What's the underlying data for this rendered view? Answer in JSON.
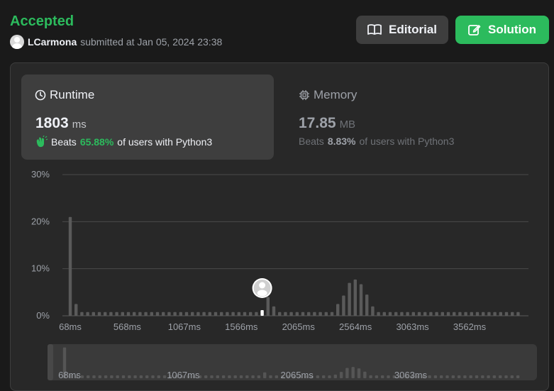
{
  "header": {
    "status": "Accepted",
    "username": "LCarmona",
    "submitted_text": "submitted at Jan 05, 2024 23:38",
    "editorial_label": "Editorial",
    "solution_label": "Solution"
  },
  "runtime": {
    "label": "Runtime",
    "value": "1803",
    "unit": "ms",
    "beats_label": "Beats",
    "beats_pct": "65.88%",
    "beats_suffix": "of users with Python3"
  },
  "memory": {
    "label": "Memory",
    "value": "17.85",
    "unit": "MB",
    "beats_label": "Beats",
    "beats_pct": "8.83%",
    "beats_suffix": "of users with Python3"
  },
  "colors": {
    "accent_green": "#2cbb5d",
    "bar": "#5a5a5a",
    "highlight_bar": "#ffffff"
  },
  "chart_data": {
    "type": "bar",
    "ylim": [
      0,
      30
    ],
    "y_ticks": [
      "30%",
      "20%",
      "10%",
      "0%"
    ],
    "x_tick_labels": [
      "68ms",
      "568ms",
      "1067ms",
      "1566ms",
      "2065ms",
      "2564ms",
      "3063ms",
      "3562ms"
    ],
    "mini_x_tick_labels": [
      "68ms",
      "1067ms",
      "2065ms",
      "3063ms"
    ],
    "values": [
      21,
      2.5,
      0.8,
      0.8,
      0.8,
      0.8,
      0.8,
      0.8,
      0.8,
      0.8,
      0.8,
      0.8,
      0.8,
      0.8,
      0.8,
      0.8,
      0.8,
      0.8,
      0.8,
      0.8,
      0.8,
      0.8,
      0.8,
      0.8,
      0.8,
      0.8,
      0.8,
      0.8,
      0.8,
      0.8,
      0.8,
      0.8,
      0.8,
      0.8,
      4,
      2,
      0.8,
      0.8,
      0.8,
      0.8,
      0.8,
      0.8,
      0.8,
      0.8,
      0.8,
      0.8,
      2.5,
      4.3,
      7,
      7.7,
      6.7,
      4.5,
      2,
      0.8,
      0.8,
      0.8,
      0.8,
      0.8,
      0.8,
      0.8,
      0.8,
      0.8,
      0.8,
      0.8,
      0.8,
      0.8,
      0.8,
      0.8,
      0.8,
      0.8,
      0.8,
      0.8,
      0.8,
      0.8,
      0.8,
      0.8,
      0.8,
      0.8
    ],
    "highlight_index": 33,
    "grid": true
  }
}
